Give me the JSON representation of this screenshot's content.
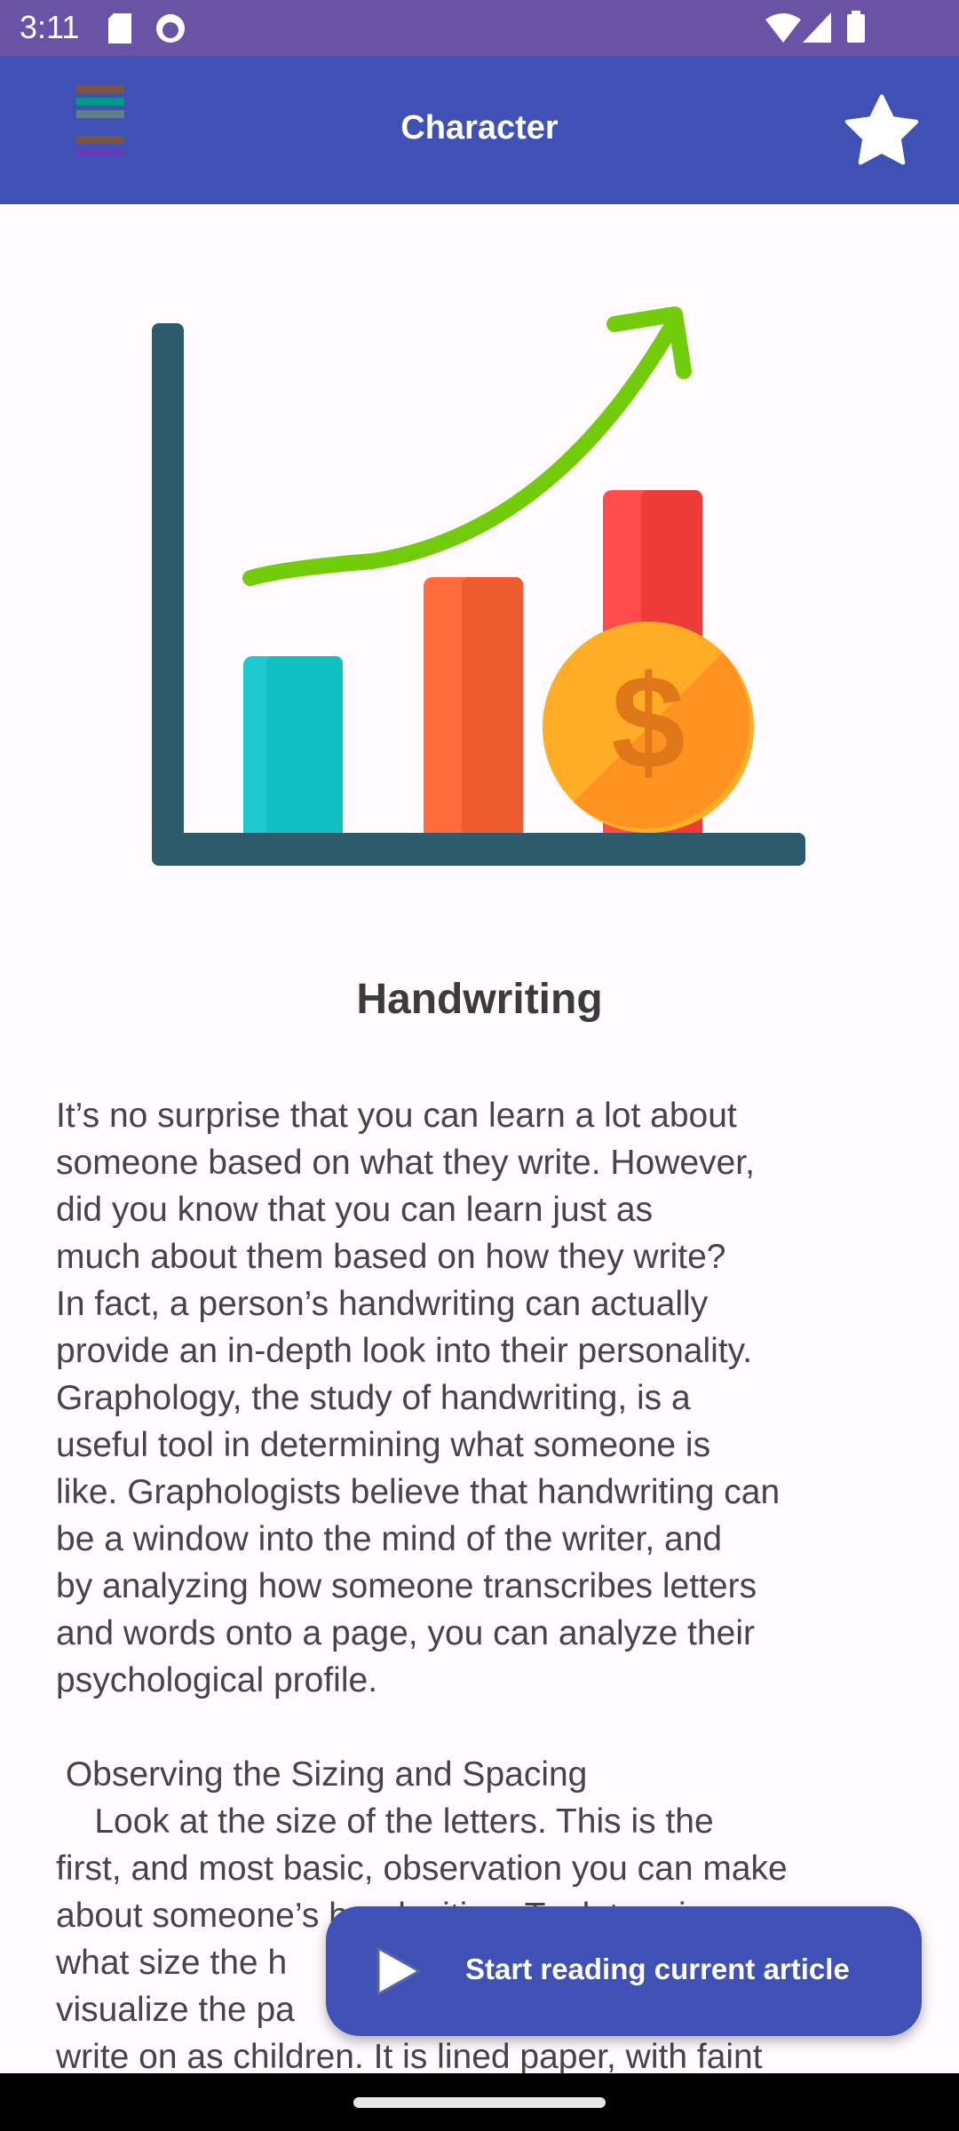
{
  "status_bar": {
    "time": "3:11",
    "icons": [
      "sd-card-icon",
      "notification-icon",
      "wifi-icon",
      "signal-icon",
      "battery-icon"
    ]
  },
  "app_bar": {
    "title": "Character",
    "menu_icon": "menu-icon",
    "favorite_icon": "star-icon"
  },
  "article": {
    "image_icon": "chart-growth-dollar-illustration",
    "title": "Handwriting",
    "lines": [
      "It’s no surprise that you can learn a lot about",
      "someone based on what they write. However,",
      "did you know that you can learn just as",
      "much about them based on how they write?",
      "In fact, a person’s handwriting can actually",
      "provide an in-depth look into their personality.",
      "Graphology, the study of handwriting, is a",
      "useful tool in determining what someone is",
      "like. Graphologists believe that handwriting can",
      "be a window into the mind of the writer, and",
      "by analyzing how someone transcribes letters",
      "and words onto a page, you can analyze their",
      "psychological profile.",
      "",
      " Observing the Sizing and Spacing",
      "    Look at the size of the letters. This is the",
      "first, and most basic, observation you can make",
      "about someone’s handwriting. To determine",
      "what size the h",
      "visualize the pa",
      "write on as children. It is lined paper, with faint"
    ]
  },
  "fab": {
    "label": "Start reading current article",
    "icon": "play-icon"
  },
  "colors": {
    "status_bar": "#6a52a6",
    "app_bar": "#3f51b5",
    "fab": "#3f51b5"
  }
}
